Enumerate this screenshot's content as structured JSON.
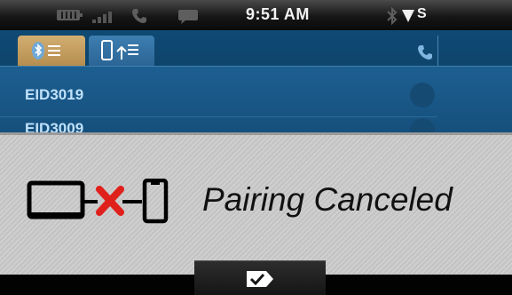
{
  "status_bar": {
    "time": "9:51 AM",
    "carrier": "S",
    "icons": [
      "battery-icon",
      "signal-icon",
      "phone-icon",
      "message-icon",
      "bluetooth-icon",
      "network-icon"
    ]
  },
  "phone_panel": {
    "tabs": [
      {
        "name": "bluetooth-devices",
        "icon": "bluetooth-list-icon",
        "selected": true
      },
      {
        "name": "phone-transfer",
        "icon": "phone-transfer-icon",
        "selected": false
      }
    ],
    "column_icon": "phone-icon",
    "devices": [
      {
        "name": "EID3019"
      },
      {
        "name": "EID3009"
      }
    ]
  },
  "dialog": {
    "message": "Pairing Canceled",
    "graphic": "pairing-failed-icon"
  },
  "bottom_bar": {
    "ok_icon": "checkmark-icon"
  },
  "colors": {
    "panel_blue": "#1d5f91",
    "tab_gold": "#c9a265",
    "cancel_red": "#e0201b",
    "dialog_gray": "#c9c9c9"
  }
}
